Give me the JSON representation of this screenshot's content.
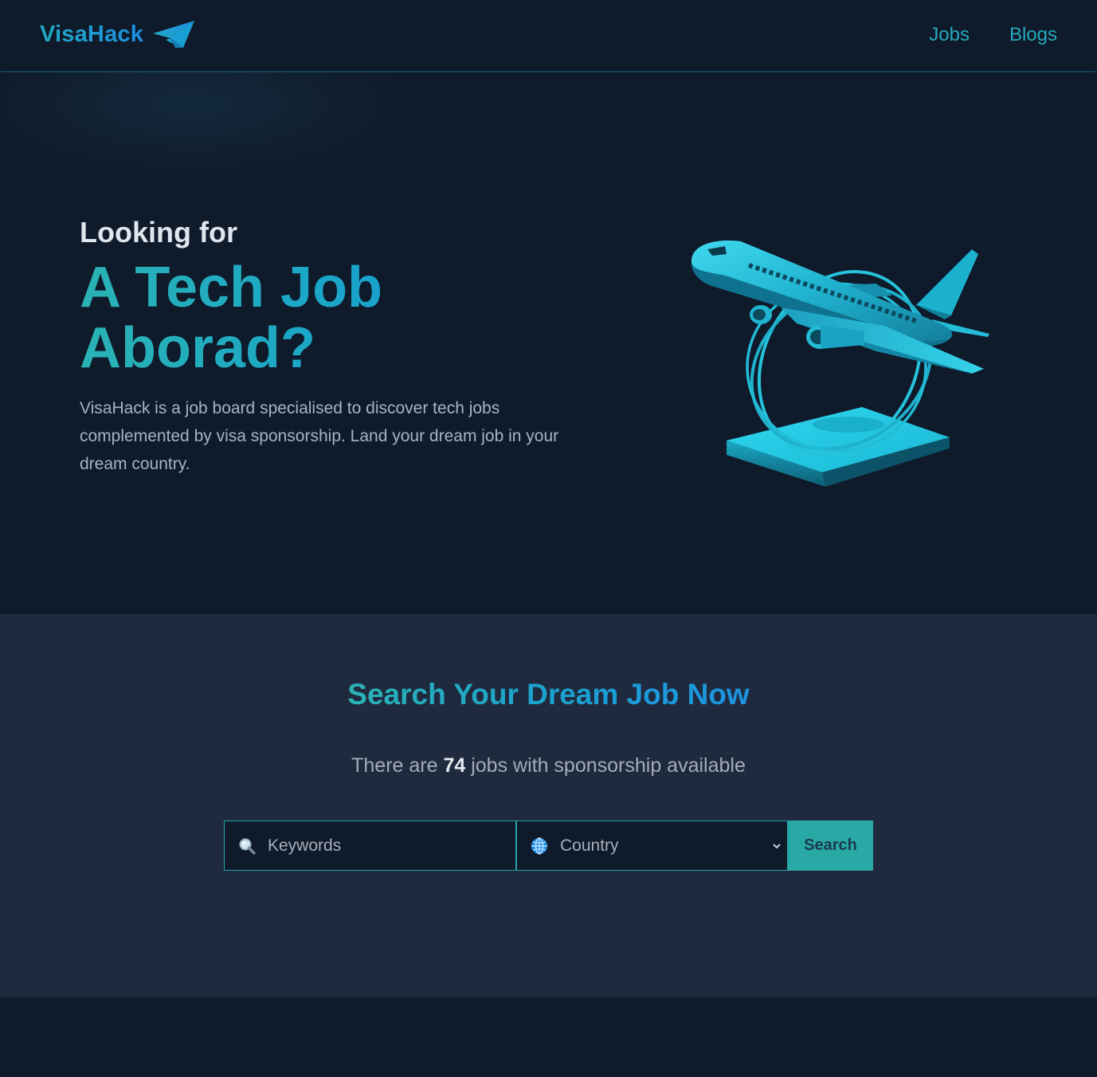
{
  "header": {
    "logo_text": "VisaHack",
    "logo_icon": "paper-plane-icon",
    "nav": [
      {
        "label": "Jobs"
      },
      {
        "label": "Blogs"
      }
    ]
  },
  "hero": {
    "intro": "Looking for",
    "title": "A Tech Job Aborad?",
    "description": "VisaHack is a job board specialised to discover tech jobs complemented by visa sponsorship. Land your dream job in your dream country.",
    "illustration": "airplane-trophy-illustration"
  },
  "search": {
    "title": "Search Your Dream Job Now",
    "count_prefix": "There are",
    "count": "74",
    "count_suffix": "jobs with sponsorship available",
    "keywords_placeholder": "Keywords",
    "keywords_icon": "magnifier-icon",
    "country_value": "Country",
    "country_icon": "globe-icon",
    "button_label": "Search"
  },
  "colors": {
    "background": "#0f1a2a",
    "section_background": "#1f2a3e",
    "accent_teal": "#28a9a6",
    "accent_blue": "#1c93e2",
    "nav_link": "#26a9bd"
  }
}
